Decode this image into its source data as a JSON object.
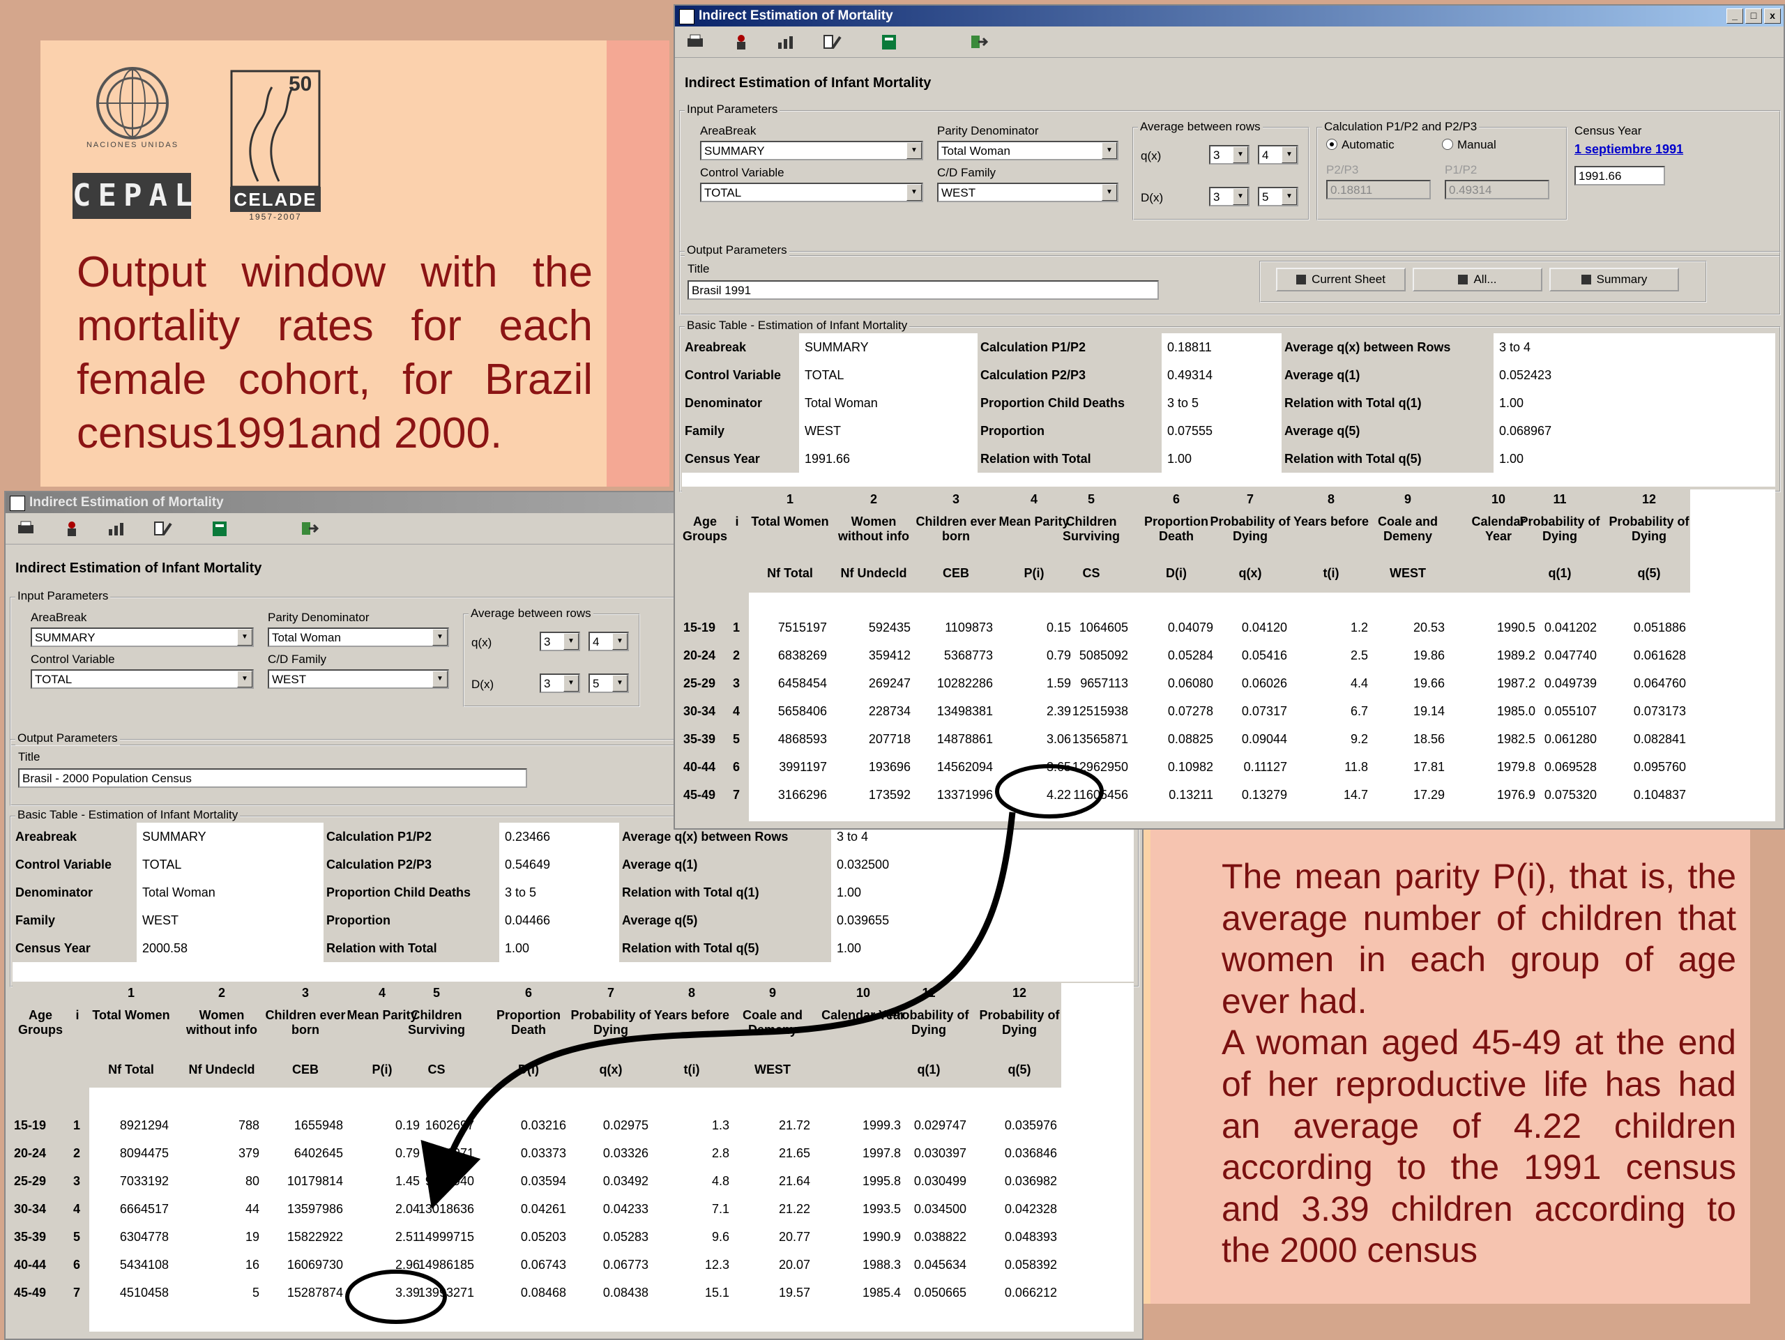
{
  "slide": {
    "heading": "Output window with the mortality rates for each female cohort, for Brazil census1991and 2000.",
    "explanation": [
      "The mean parity P(i), that is, the average number of children that women in each group of age ever had.",
      "A woman aged 45-49 at the end of her reproductive life has had an average of 4.22 children according to the 1991 census and 3.39 children according to the 2000 census"
    ],
    "logos": {
      "un_caption": "NACIONES UNIDAS",
      "cepal": "CEPAL",
      "celade": "CELADE",
      "celade_50": "50",
      "celade_years": "1957-2007"
    },
    "colors": {
      "heading": "#8b1414",
      "explanation": "#7a1010",
      "window_face": "#d4d0c8",
      "titlebar_active": "#0a246a"
    }
  },
  "windows": [
    {
      "id": "1991",
      "title": "Indirect Estimation of Mortality",
      "controls": [
        "_",
        "□",
        "x"
      ],
      "toolbar": [
        "print-icon",
        "person-icon",
        "chart-icon",
        "tools-icon",
        "sheet-icon",
        "exit-icon"
      ],
      "app_title": "Indirect Estimation of Infant Mortality",
      "input": {
        "group": "Input Parameters",
        "areabreak_label": "AreaBreak",
        "areabreak": "SUMMARY",
        "parity_label": "Parity Denominator",
        "parity": "Total Woman",
        "avg_label": "Average between rows",
        "qx_label": "q(x)",
        "qx_from": "3",
        "qx_to": "4",
        "dx_label": "D(x)",
        "dx_from": "3",
        "dx_to": "5",
        "control_label": "Control Variable",
        "control": "TOTAL",
        "family_label": "C/D Family",
        "family": "WEST",
        "calc_label": "Calculation P1/P2 and P2/P3",
        "auto_label": "Automatic",
        "manual_label": "Manual",
        "p2p3_label": "P2/P3",
        "p2p3": "0.18811",
        "p1p2_label": "P1/P2",
        "p1p2": "0.49314",
        "census_label": "Census Year",
        "census_link": "1 septiembre 1991",
        "census_value": "1991.66"
      },
      "output": {
        "group": "Output Parameters",
        "title_label": "Title",
        "title_value": "Brasil 1991",
        "buttons": [
          "Current Sheet",
          "All...",
          "Summary"
        ]
      },
      "basic": {
        "group": "Basic Table - Estimation of Infant Mortality",
        "rows": [
          [
            "Areabreak",
            "SUMMARY",
            "Calculation P1/P2",
            "0.18811",
            "Average q(x) between Rows",
            "3 to 4"
          ],
          [
            "Control Variable",
            "TOTAL",
            "Calculation P2/P3",
            "0.49314",
            "Average q(1)",
            "0.052423"
          ],
          [
            "Denominator",
            "Total Woman",
            "Proportion Child Deaths",
            "3 to 5",
            "Relation with Total q(1)",
            "1.00"
          ],
          [
            "Family",
            "WEST",
            "Proportion",
            "0.07555",
            "Average q(5)",
            "0.068967"
          ],
          [
            "Census Year",
            "1991.66",
            "Relation with Total",
            "1.00",
            "Relation with Total q(5)",
            "1.00"
          ]
        ]
      },
      "grid": {
        "numbers": [
          "1",
          "2",
          "3",
          "4",
          "5",
          "6",
          "7",
          "8",
          "9",
          "10",
          "11",
          "12"
        ],
        "names": [
          "Total Women",
          "Women without info",
          "Children ever born",
          "Mean Parity",
          "Children Surviving",
          "Proportion Death",
          "Probability of Dying",
          "Years before",
          "Coale and Demeny",
          "Calendar Year",
          "Probability of Dying",
          "Probability of Dying"
        ],
        "codes": [
          "Nf Total",
          "Nf Undecld",
          "CEB",
          "P(i)",
          "CS",
          "D(i)",
          "q(x)",
          "t(i)",
          "WEST",
          "",
          "q(1)",
          "q(5)"
        ],
        "age_header": "Age Groups",
        "i_header": "i",
        "rows": [
          [
            "15-19",
            "1",
            "7515197",
            "592435",
            "1109873",
            "0.15",
            "1064605",
            "0.04079",
            "0.04120",
            "1.2",
            "20.53",
            "1990.5",
            "0.041202",
            "0.051886"
          ],
          [
            "20-24",
            "2",
            "6838269",
            "359412",
            "5368773",
            "0.79",
            "5085092",
            "0.05284",
            "0.05416",
            "2.5",
            "19.86",
            "1989.2",
            "0.047740",
            "0.061628"
          ],
          [
            "25-29",
            "3",
            "6458454",
            "269247",
            "10282286",
            "1.59",
            "9657113",
            "0.06080",
            "0.06026",
            "4.4",
            "19.66",
            "1987.2",
            "0.049739",
            "0.064760"
          ],
          [
            "30-34",
            "4",
            "5658406",
            "228734",
            "13498381",
            "2.39",
            "12515938",
            "0.07278",
            "0.07317",
            "6.7",
            "19.14",
            "1985.0",
            "0.055107",
            "0.073173"
          ],
          [
            "35-39",
            "5",
            "4868593",
            "207718",
            "14878861",
            "3.06",
            "13565871",
            "0.08825",
            "0.09044",
            "9.2",
            "18.56",
            "1982.5",
            "0.061280",
            "0.082841"
          ],
          [
            "40-44",
            "6",
            "3991197",
            "193696",
            "14562094",
            "3.65",
            "12962950",
            "0.10982",
            "0.11127",
            "11.8",
            "17.81",
            "1979.8",
            "0.069528",
            "0.095760"
          ],
          [
            "45-49",
            "7",
            "3166296",
            "173592",
            "13371996",
            "4.22",
            "11605456",
            "0.13211",
            "0.13279",
            "14.7",
            "17.29",
            "1976.9",
            "0.075320",
            "0.104837"
          ]
        ]
      }
    },
    {
      "id": "2000",
      "title": "Indirect Estimation of Mortality",
      "toolbar": [
        "print-icon",
        "person-icon",
        "chart-icon",
        "tools-icon",
        "sheet-icon",
        "exit-icon"
      ],
      "app_title": "Indirect Estimation of Infant Mortality",
      "input": {
        "group": "Input Parameters",
        "areabreak_label": "AreaBreak",
        "areabreak": "SUMMARY",
        "parity_label": "Parity Denominator",
        "parity": "Total Woman",
        "avg_label": "Average between rows",
        "qx_label": "q(x)",
        "qx_from": "3",
        "qx_to": "4",
        "dx_label": "D(x)",
        "dx_from": "3",
        "dx_to": "5",
        "control_label": "Control Variable",
        "control": "TOTAL",
        "family_label": "C/D Family",
        "family": "WEST"
      },
      "output": {
        "group": "Output Parameters",
        "title_label": "Title",
        "title_value": "Brasil - 2000 Population Census"
      },
      "basic": {
        "group": "Basic Table - Estimation of Infant Mortality",
        "rows": [
          [
            "Areabreak",
            "SUMMARY",
            "Calculation P1/P2",
            "0.23466",
            "Average q(x) between Rows",
            "3 to 4"
          ],
          [
            "Control Variable",
            "TOTAL",
            "Calculation P2/P3",
            "0.54649",
            "Average q(1)",
            "0.032500"
          ],
          [
            "Denominator",
            "Total Woman",
            "Proportion Child Deaths",
            "3 to 5",
            "Relation with Total q(1)",
            "1.00"
          ],
          [
            "Family",
            "WEST",
            "Proportion",
            "0.04466",
            "Average q(5)",
            "0.039655"
          ],
          [
            "Census Year",
            "2000.58",
            "Relation with Total",
            "1.00",
            "Relation with Total q(5)",
            "1.00"
          ]
        ]
      },
      "grid": {
        "numbers": [
          "1",
          "2",
          "3",
          "4",
          "5",
          "6",
          "7",
          "8",
          "9",
          "10",
          "11",
          "12"
        ],
        "names": [
          "Total Women",
          "Women without info",
          "Children ever born",
          "Mean Parity",
          "Children Surviving",
          "Proportion Death",
          "Probability of Dying",
          "Years before",
          "Coale and Demeny",
          "Calendar Year",
          "Probability of Dying",
          "Probability of Dying"
        ],
        "codes": [
          "Nf Total",
          "Nf Undecld",
          "CEB",
          "P(i)",
          "CS",
          "D(i)",
          "q(x)",
          "t(i)",
          "WEST",
          "",
          "q(1)",
          "q(5)"
        ],
        "age_header": "Age Groups",
        "i_header": "i",
        "rows": [
          [
            "15-19",
            "1",
            "8921294",
            "788",
            "1655948",
            "0.19",
            "1602697",
            "0.03216",
            "0.02975",
            "1.3",
            "21.72",
            "1999.3",
            "0.029747",
            "0.035976"
          ],
          [
            "20-24",
            "2",
            "8094475",
            "379",
            "6402645",
            "0.79",
            "6186971",
            "0.03373",
            "0.03326",
            "2.8",
            "21.65",
            "1997.8",
            "0.030397",
            "0.036846"
          ],
          [
            "25-29",
            "3",
            "7033192",
            "80",
            "10179814",
            "1.45",
            "9813940",
            "0.03594",
            "0.03492",
            "4.8",
            "21.64",
            "1995.8",
            "0.030499",
            "0.036982"
          ],
          [
            "30-34",
            "4",
            "6664517",
            "44",
            "13597986",
            "2.04",
            "13018636",
            "0.04261",
            "0.04233",
            "7.1",
            "21.22",
            "1993.5",
            "0.034500",
            "0.042328"
          ],
          [
            "35-39",
            "5",
            "6304778",
            "19",
            "15822922",
            "2.51",
            "14999715",
            "0.05203",
            "0.05283",
            "9.6",
            "20.77",
            "1990.9",
            "0.038822",
            "0.048393"
          ],
          [
            "40-44",
            "6",
            "5434108",
            "16",
            "16069730",
            "2.96",
            "14986185",
            "0.06743",
            "0.06773",
            "12.3",
            "20.07",
            "1988.3",
            "0.045634",
            "0.058392"
          ],
          [
            "45-49",
            "7",
            "4510458",
            "5",
            "15287874",
            "3.39",
            "13993271",
            "0.08468",
            "0.08438",
            "15.1",
            "19.57",
            "1985.4",
            "0.050665",
            "0.066212"
          ]
        ]
      }
    }
  ]
}
